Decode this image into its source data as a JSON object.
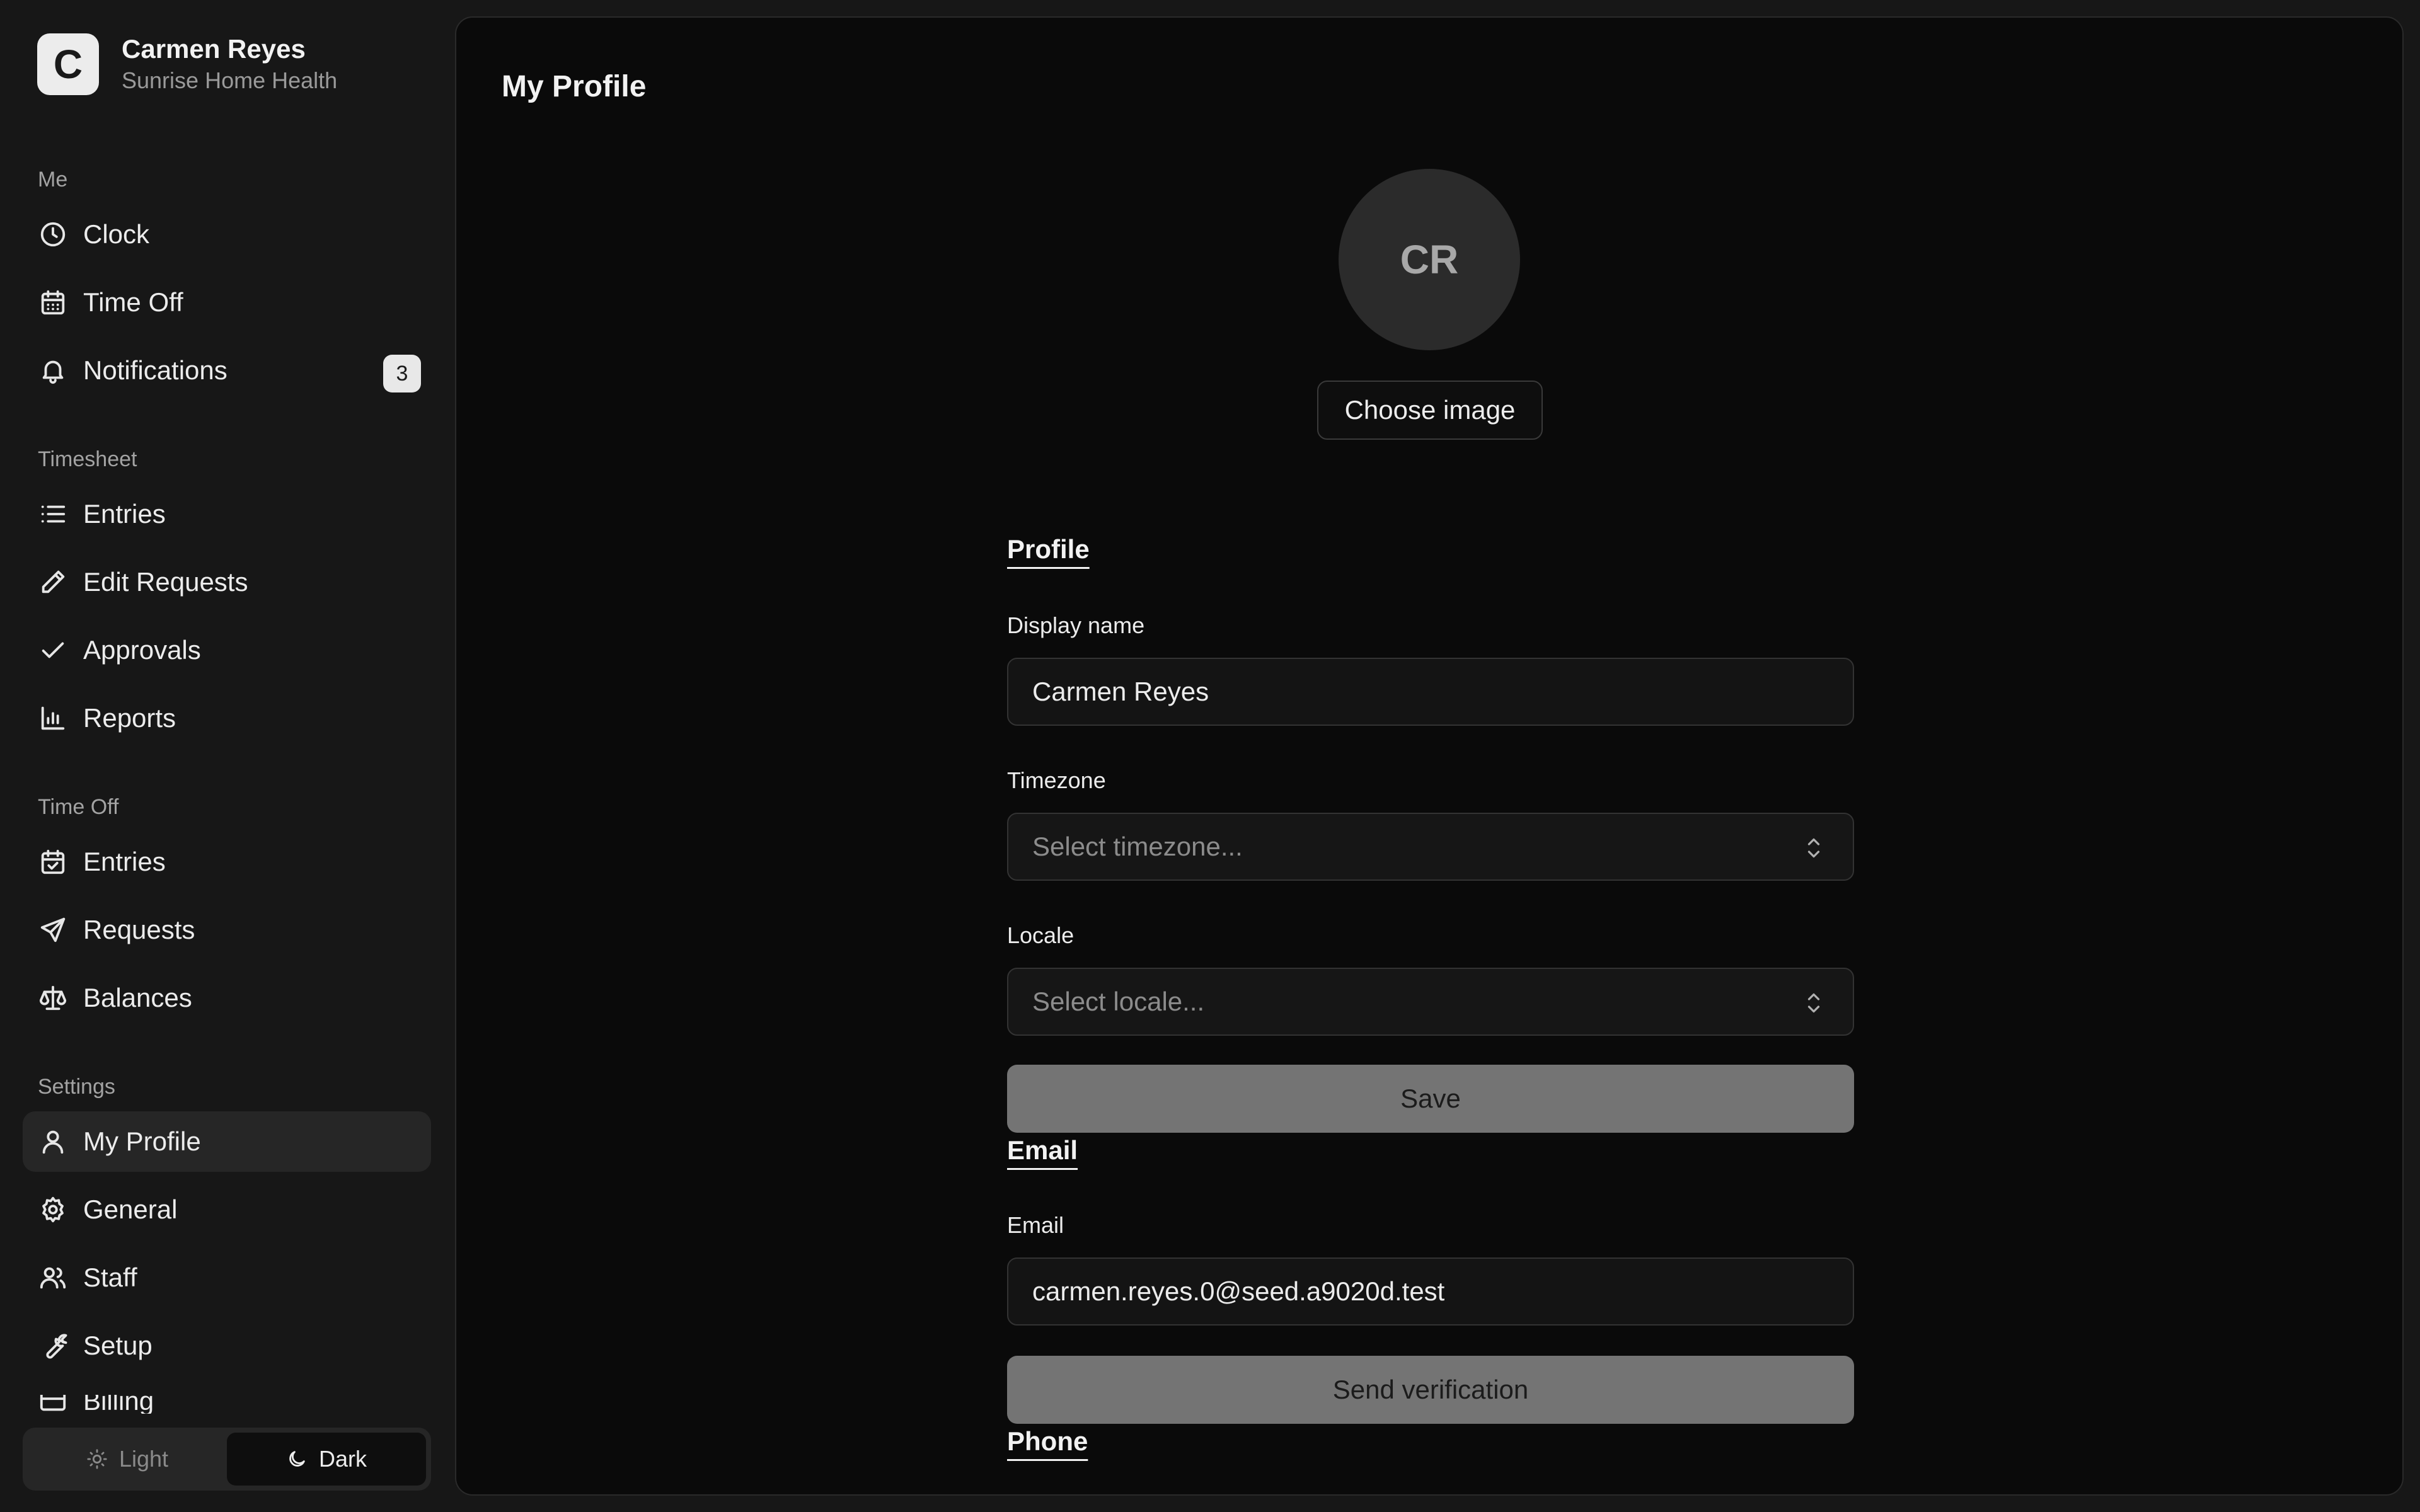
{
  "org": {
    "logo_letter": "C",
    "user_name": "Carmen Reyes",
    "org_name": "Sunrise Home Health"
  },
  "sidebar": {
    "sections": {
      "me": "Me",
      "timesheet": "Timesheet",
      "time_off": "Time Off",
      "settings": "Settings"
    },
    "items": {
      "clock": "Clock",
      "time_off": "Time Off",
      "notifications": "Notifications",
      "notifications_badge": "3",
      "ts_entries": "Entries",
      "edit_requests": "Edit Requests",
      "approvals": "Approvals",
      "reports": "Reports",
      "to_entries": "Entries",
      "requests": "Requests",
      "balances": "Balances",
      "my_profile": "My Profile",
      "general": "General",
      "staff": "Staff",
      "setup": "Setup",
      "billing": "Billing"
    },
    "active_item": "my_profile",
    "theme": {
      "light": "Light",
      "dark": "Dark",
      "selected": "dark"
    }
  },
  "main": {
    "title": "My Profile",
    "avatar_initials": "CR",
    "choose_image": "Choose image",
    "profile_section": {
      "heading": "Profile",
      "display_name_label": "Display name",
      "display_name_value": "Carmen Reyes",
      "timezone_label": "Timezone",
      "timezone_placeholder": "Select timezone...",
      "locale_label": "Locale",
      "locale_placeholder": "Select locale...",
      "save": "Save"
    },
    "email_section": {
      "heading": "Email",
      "email_label": "Email",
      "email_value": "carmen.reyes.0@seed.a9020d.test",
      "send_verification": "Send verification"
    },
    "phone_section": {
      "heading": "Phone"
    }
  },
  "icons": {
    "clock": "clock-icon",
    "time_off": "calendar-icon",
    "notifications": "bell-icon",
    "ts_entries": "list-icon",
    "edit_requests": "pencil-icon",
    "approvals": "check-icon",
    "reports": "bar-chart-icon",
    "to_entries": "calendar-check-icon",
    "requests": "send-icon",
    "balances": "scale-icon",
    "my_profile": "user-icon",
    "general": "gear-icon",
    "staff": "users-icon",
    "setup": "wrench-icon",
    "billing": "credit-card-icon",
    "light": "sun-icon",
    "dark": "moon-icon",
    "select": "chevrons-up-down-icon"
  },
  "colors": {
    "sidebar_bg": "#171717",
    "main_bg": "#0a0a0a",
    "active_item_bg": "#262626",
    "button_bg": "#747474"
  }
}
